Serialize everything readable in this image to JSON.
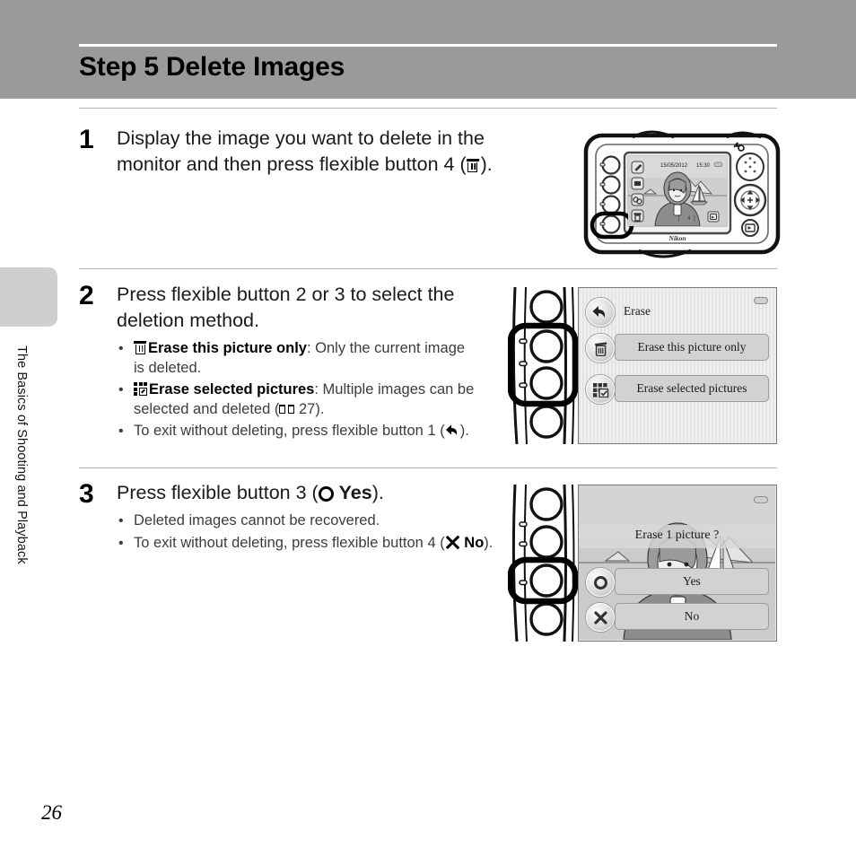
{
  "page": {
    "title": "Step 5 Delete Images",
    "number": "26",
    "side_tab_label": "The Basics of Shooting and Playback"
  },
  "steps": [
    {
      "number": "1",
      "lead_part1": "Display the image you want to delete in the monitor and then press flexible button 4 (",
      "lead_icon": "trash-icon",
      "lead_part2": ").",
      "bullets": [],
      "illustration": {
        "kind": "camera-back",
        "brand": "Nikon",
        "lcd": {
          "date": "15/05/2012",
          "time": "15:30",
          "icons": [
            "edit-icon",
            "slideshow-icon",
            "connect-icon",
            "trash-icon"
          ],
          "playback_icon": "playback-icon"
        },
        "highlighted_button": 4
      }
    },
    {
      "number": "2",
      "lead_part1": "Press flexible button 2 or 3 to select the deletion method.",
      "lead_icon": "",
      "lead_part2": "",
      "bullets": [
        {
          "icon": "trash-icon",
          "bold": "Erase this picture only",
          "text": ": Only the current image is deleted."
        },
        {
          "icon": "grid-select-icon",
          "bold": "Erase selected pictures",
          "text": ": Multiple images can be selected and deleted (",
          "ref_icon": "book-icon",
          "ref_page": "27",
          "text_after": ")."
        },
        {
          "icon": "",
          "bold": "",
          "text": "To exit without deleting, press flexible button 1 (",
          "trailing_icon": "back-arrow-icon",
          "text_after": ")."
        }
      ],
      "illustration": {
        "kind": "menu-screen",
        "menu_title": "Erase",
        "menu_title_icon": "back-arrow-icon",
        "items": [
          {
            "icon": "trash-icon",
            "label": "Erase this picture only"
          },
          {
            "icon": "grid-select-icon",
            "label": "Erase selected pictures"
          }
        ],
        "battery_icon": "battery-icon",
        "highlighted_buttons": [
          2,
          3
        ]
      }
    },
    {
      "number": "3",
      "lead_part1": "Press flexible button 3 (",
      "lead_icon": "circle-icon",
      "lead_bold": "Yes",
      "lead_part2": ").",
      "bullets": [
        {
          "icon": "",
          "bold": "",
          "text": "Deleted images cannot be recovered."
        },
        {
          "icon": "",
          "bold": "",
          "text": "To exit without deleting, press flexible button 4 (",
          "trailing_icon": "cross-icon",
          "trailing_bold": "No",
          "text_after": ")."
        }
      ],
      "illustration": {
        "kind": "confirm-screen",
        "prompt": "Erase 1 picture ?",
        "options": [
          {
            "icon": "circle-icon",
            "label": "Yes"
          },
          {
            "icon": "cross-icon",
            "label": "No"
          }
        ],
        "battery_icon": "battery-icon",
        "highlighted_button": 3
      }
    }
  ],
  "colors": {
    "header_band": "#9a9a9a",
    "side_tab": "#cfcfcf",
    "rule": "#b4b4b4",
    "screen_bg": "#e8e8e8",
    "pill": "#d2d2d2"
  }
}
